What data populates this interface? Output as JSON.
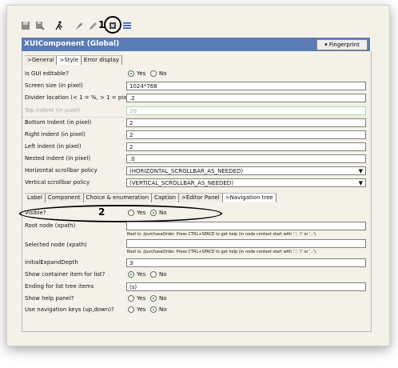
{
  "toolbar": {
    "icons": [
      "save-icon",
      "save-as-icon",
      "run-icon",
      "pin-icon",
      "edit-icon",
      "component-icon",
      "list-icon"
    ],
    "marker": "1"
  },
  "title": "XUIComponent (Global)",
  "fingerprint_label": "▾ Fingerprint",
  "top_tabs": [
    ">General",
    ">Style",
    "Error display"
  ],
  "fields": {
    "gui_editable": {
      "label": "Is GUI editable?",
      "yes": "Yes",
      "no": "No"
    },
    "screen_size": {
      "label": "Screen size (in pixel)",
      "value": "1024*768"
    },
    "divider": {
      "label": "Divider location (< 1 = %, > 1 = pixel)",
      "value": ".2"
    },
    "top_indent": {
      "label": "Top indent (in pixel)",
      "value": "20"
    },
    "bottom_indent": {
      "label": "Bottom Indent (in pixel)",
      "value": "2"
    },
    "right_indent": {
      "label": "Right indent (in pixel)",
      "value": "2"
    },
    "left_indent": {
      "label": "Left indent (in pixel)",
      "value": "2"
    },
    "nested_indent": {
      "label": "Nested indent (in pixel)",
      "value": ".0"
    },
    "h_scroll": {
      "label": "Horizontal scrollbar policy",
      "value": "(HORIZONTAL_SCROLLBAR_AS_NEEDED)"
    },
    "v_scroll": {
      "label": "Vertical scrollbar policy",
      "value": "(VERTICAL_SCROLLBAR_AS_NEEDED)"
    }
  },
  "sub_tabs": [
    "Label",
    "Component",
    "Choice & enumeration",
    "Caption",
    ">Editor Panel",
    ">Navigation tree"
  ],
  "nav": {
    "visible": {
      "label": "Visible?",
      "yes": "Yes",
      "no": "No",
      "marker": "2"
    },
    "root_node": {
      "label": "Root node (xpath)",
      "value": ""
    },
    "root_hint": "Root is: /purchaseOrder. Press CTRL+SPACE to get help (in node context start with '.', '/' or '..').",
    "selected_node": {
      "label": "Selected node (xpath)",
      "value": ""
    },
    "selected_hint": "Root is: /purchaseOrder. Press CTRL+SPACE to get help (in node context start with '.', '/' or '..').",
    "expand_depth": {
      "label": "initialExpandDepth",
      "value": "3"
    },
    "show_container": {
      "label": "Show container item for list?",
      "yes": "Yes",
      "no": "No"
    },
    "ending": {
      "label": "Ending for list tree items",
      "value": "(s)"
    },
    "help_panel": {
      "label": "Show help panel?",
      "yes": "Yes",
      "no": "No"
    },
    "nav_keys": {
      "label": "Use navigation keys (up,down)?",
      "yes": "Yes",
      "no": "No"
    }
  },
  "colors": {
    "title_bar": "#5b7bb5",
    "panel": "#f4f1e8",
    "radio_on": "#2a8a2a"
  }
}
